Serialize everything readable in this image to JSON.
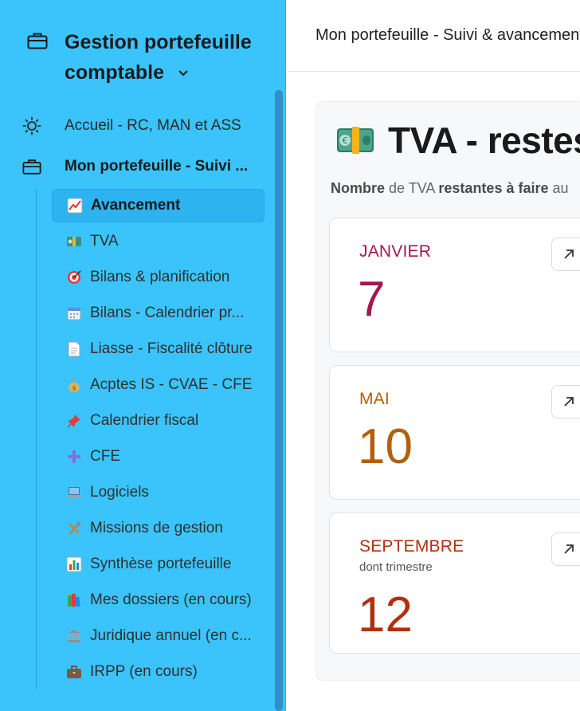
{
  "sidebar": {
    "workspace_title": "Gestion portefeuille comptable",
    "nav_top": [
      {
        "label": "Accueil - RC, MAN et ASS",
        "icon": "sun-icon"
      },
      {
        "label": "Mon portefeuille - Suivi ...",
        "icon": "briefcase-icon"
      }
    ],
    "sub_items": [
      {
        "label": "Avancement",
        "icon": "chart-increasing-icon",
        "emoji": "📈"
      },
      {
        "label": "TVA",
        "icon": "euro-banknote-icon",
        "emoji": "💶"
      },
      {
        "label": "Bilans & planification",
        "icon": "direct-hit-icon",
        "emoji": "🎯"
      },
      {
        "label": "Bilans - Calendrier pr...",
        "icon": "calendar-icon",
        "emoji": "📅"
      },
      {
        "label": "Liasse - Fiscalité clôture",
        "icon": "page-icon",
        "emoji": "📄"
      },
      {
        "label": "Acptes IS - CVAE - CFE",
        "icon": "money-bag-icon",
        "emoji": "💰"
      },
      {
        "label": "Calendrier fiscal",
        "icon": "pushpin-icon",
        "emoji": "📌"
      },
      {
        "label": "CFE",
        "icon": "plus-icon",
        "emoji": "➕"
      },
      {
        "label": "Logiciels",
        "icon": "laptop-icon",
        "emoji": "💻"
      },
      {
        "label": "Missions de gestion",
        "icon": "tools-icon",
        "emoji": "🛠"
      },
      {
        "label": "Synthèse portefeuille",
        "icon": "bar-chart-icon",
        "emoji": "📊"
      },
      {
        "label": "Mes dossiers (en cours)",
        "icon": "books-icon",
        "emoji": "📚"
      },
      {
        "label": "Juridique annuel (en c...",
        "icon": "bank-icon",
        "emoji": "🏛"
      },
      {
        "label": "IRPP (en cours)",
        "icon": "briefcase-icon",
        "emoji": "💼"
      }
    ]
  },
  "header": {
    "breadcrumb": "Mon portefeuille - Suivi & avancement"
  },
  "page": {
    "title": "TVA - restes",
    "subtitle": {
      "part1": "Nombre",
      "part2": " de TVA ",
      "part3": "restantes à faire",
      "part4": " au"
    }
  },
  "cards": [
    {
      "month": "JANVIER",
      "note": "",
      "value": "7",
      "color": "#a3174a"
    },
    {
      "month": "MAI",
      "note": "",
      "value": "10",
      "color": "#b3600b"
    },
    {
      "month": "SEPTEMBRE",
      "note": "dont trimestre",
      "value": "12",
      "color": "#b0300f"
    }
  ],
  "colors": {
    "sidebar_bg": "#3bc4fb",
    "active_item_bg": "#2db3f0"
  }
}
